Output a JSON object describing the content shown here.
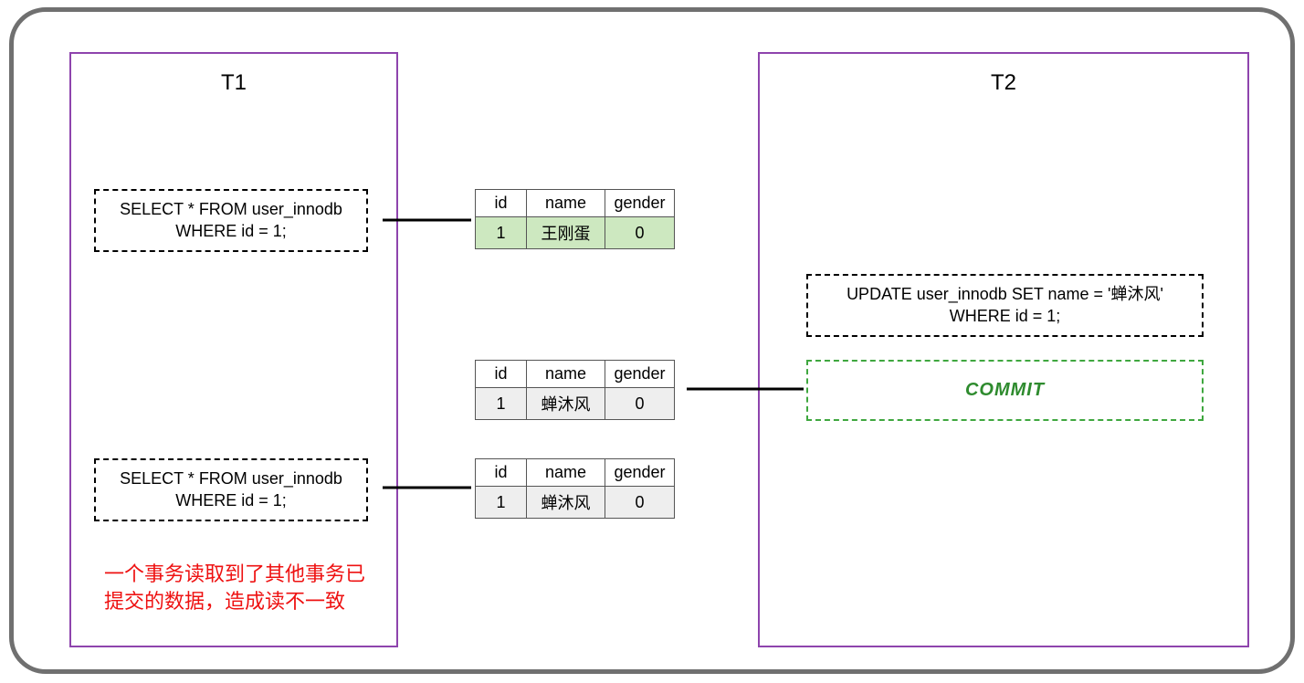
{
  "tx1": {
    "title": "T1"
  },
  "tx2": {
    "title": "T2"
  },
  "sql": {
    "select1_l1": "SELECT * FROM user_innodb",
    "select1_l2": "WHERE id = 1;",
    "select2_l1": "SELECT * FROM user_innodb",
    "select2_l2": "WHERE id = 1;",
    "update_l1": "UPDATE user_innodb SET name = '蝉沐风'",
    "update_l2": "WHERE id = 1;",
    "commit": "COMMIT"
  },
  "headers": {
    "id": "id",
    "name": "name",
    "gender": "gender"
  },
  "rows": {
    "r1": {
      "id": "1",
      "name": "王刚蛋",
      "gender": "0"
    },
    "r2": {
      "id": "1",
      "name": "蝉沐风",
      "gender": "0"
    },
    "r3": {
      "id": "1",
      "name": "蝉沐风",
      "gender": "0"
    }
  },
  "annotation": {
    "l1": "一个事务读取到了其他事务已",
    "l2": "提交的数据，造成读不一致"
  }
}
